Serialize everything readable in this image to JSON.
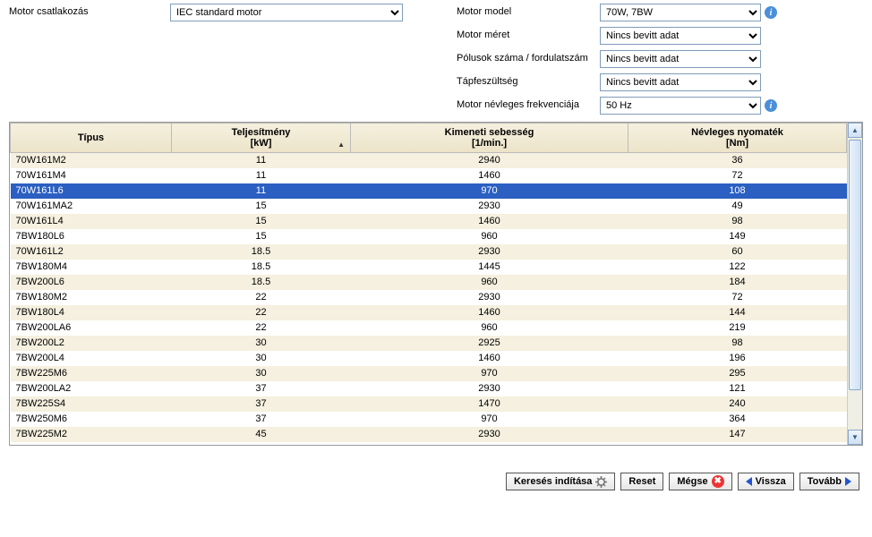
{
  "form": {
    "left": {
      "motor_csatlakozas": {
        "label": "Motor csatlakozás",
        "value": "IEC standard motor"
      }
    },
    "right": {
      "motor_model": {
        "label": "Motor model",
        "value": "70W, 7BW",
        "info": true
      },
      "motor_meret": {
        "label": "Motor méret",
        "value": "Nincs bevitt adat"
      },
      "polusok": {
        "label": "Pólusok száma / fordulatszám",
        "value": "Nincs bevitt adat"
      },
      "tapfesz": {
        "label": "Tápfeszültség",
        "value": "Nincs bevitt adat"
      },
      "frekvencia": {
        "label": "Motor névleges frekvenciája",
        "value": "50 Hz",
        "info": true
      }
    }
  },
  "table": {
    "headers": {
      "tipus": "Típus",
      "teljesitmeny": "Teljesítmény\n[kW]",
      "kimeneti": "Kimeneti sebesség\n[1/min.]",
      "nyomatek": "Névleges nyomaték\n[Nm]"
    },
    "sorted_col": "teljesitmeny",
    "selected": "70W161L6",
    "rows": [
      {
        "tipus": "70W161M2",
        "kw": "11",
        "rpm": "2940",
        "nm": "36"
      },
      {
        "tipus": "70W161M4",
        "kw": "11",
        "rpm": "1460",
        "nm": "72"
      },
      {
        "tipus": "70W161L6",
        "kw": "11",
        "rpm": "970",
        "nm": "108"
      },
      {
        "tipus": "70W161MA2",
        "kw": "15",
        "rpm": "2930",
        "nm": "49"
      },
      {
        "tipus": "70W161L4",
        "kw": "15",
        "rpm": "1460",
        "nm": "98"
      },
      {
        "tipus": "7BW180L6",
        "kw": "15",
        "rpm": "960",
        "nm": "149"
      },
      {
        "tipus": "70W161L2",
        "kw": "18.5",
        "rpm": "2930",
        "nm": "60"
      },
      {
        "tipus": "7BW180M4",
        "kw": "18.5",
        "rpm": "1445",
        "nm": "122"
      },
      {
        "tipus": "7BW200L6",
        "kw": "18.5",
        "rpm": "960",
        "nm": "184"
      },
      {
        "tipus": "7BW180M2",
        "kw": "22",
        "rpm": "2930",
        "nm": "72"
      },
      {
        "tipus": "7BW180L4",
        "kw": "22",
        "rpm": "1460",
        "nm": "144"
      },
      {
        "tipus": "7BW200LA6",
        "kw": "22",
        "rpm": "960",
        "nm": "219"
      },
      {
        "tipus": "7BW200L2",
        "kw": "30",
        "rpm": "2925",
        "nm": "98"
      },
      {
        "tipus": "7BW200L4",
        "kw": "30",
        "rpm": "1460",
        "nm": "196"
      },
      {
        "tipus": "7BW225M6",
        "kw": "30",
        "rpm": "970",
        "nm": "295"
      },
      {
        "tipus": "7BW200LA2",
        "kw": "37",
        "rpm": "2930",
        "nm": "121"
      },
      {
        "tipus": "7BW225S4",
        "kw": "37",
        "rpm": "1470",
        "nm": "240"
      },
      {
        "tipus": "7BW250M6",
        "kw": "37",
        "rpm": "970",
        "nm": "364"
      },
      {
        "tipus": "7BW225M2",
        "kw": "45",
        "rpm": "2930",
        "nm": "147"
      }
    ]
  },
  "buttons": {
    "search": "Keresés indítása",
    "reset": "Reset",
    "cancel": "Mégse",
    "back": "Vissza",
    "next": "Tovább"
  }
}
